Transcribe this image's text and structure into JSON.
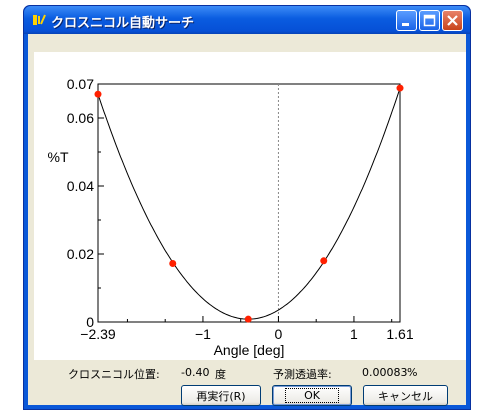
{
  "window": {
    "title": "クロスニコル自動サーチ"
  },
  "chart_data": {
    "type": "line",
    "xlabel": "Angle [deg]",
    "ylabel": "%T",
    "xlim": [
      -2.39,
      1.61
    ],
    "ylim": [
      0,
      0.07
    ],
    "x_ticks": [
      "-2.39",
      "-1",
      "0",
      "1",
      "1.61"
    ],
    "y_ticks": [
      "0.07",
      "0.06",
      "0.04",
      "0.02",
      "0"
    ],
    "points": {
      "x": [
        -2.39,
        -1.4,
        -0.4,
        0.6,
        1.61
      ],
      "y": [
        0.067,
        0.0172,
        0.00083,
        0.018,
        0.0688
      ]
    },
    "curve_vertex": {
      "x": -0.4,
      "y": 0.00083
    },
    "vline_x": 0,
    "grid": false,
    "point_color": "#ff2000",
    "curve_color": "#000000"
  },
  "status": {
    "position_label": "クロスニコル位置:",
    "position_value": "-0.40",
    "position_unit": "度",
    "transmittance_label": "予測透過率:",
    "transmittance_value": "0.00083",
    "transmittance_unit": "%"
  },
  "buttons": {
    "rerun": "再実行(R)",
    "ok": "OK",
    "cancel": "キャンセル"
  },
  "icons": {
    "app": "app-icon",
    "minimize": "minimize-icon",
    "maximize": "maximize-icon",
    "close": "close-icon"
  }
}
